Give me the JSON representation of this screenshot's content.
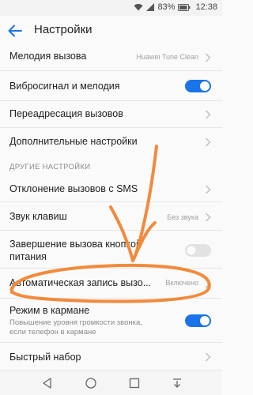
{
  "status_bar": {
    "battery_percent": "83%",
    "time": "12:38"
  },
  "header": {
    "title": "Настройки"
  },
  "settings": {
    "ringtone": {
      "label": "Мелодия вызова",
      "value": "Huawei Tune Clean"
    },
    "vibrate_ring": {
      "label": "Вибросигнал и мелодия",
      "enabled": true
    },
    "forwarding": {
      "label": "Переадресация вызовов"
    },
    "additional": {
      "label": "Дополнительные настройки"
    }
  },
  "other_section": {
    "title": "ДРУГИЕ НАСТРОЙКИ",
    "sms_decline": {
      "label": "Отклонение вызовов с SMS"
    },
    "keypad_sound": {
      "label": "Звук клавиш",
      "value": "Без звука"
    },
    "power_end_call": {
      "label_line1": "Завершение вызова кнопкой",
      "label_line2": "питания",
      "enabled": false
    },
    "auto_record": {
      "label": "Автоматическая запись вызо...",
      "value": "Включено"
    },
    "pocket_mode": {
      "label": "Режим в кармане",
      "description_line1": "Повышение уровня громкости звонка,",
      "description_line2": "если телефон в кармане",
      "enabled": true
    },
    "speed_dial": {
      "label": "Быстрый набор"
    }
  },
  "colors": {
    "accent": "#1a73e8",
    "annotation": "#f28a3c"
  },
  "icons": {
    "back": "arrow-left-icon",
    "wifi": "wifi-icon",
    "signal": "signal-icon",
    "battery": "battery-icon",
    "chevron": "chevron-right-icon"
  }
}
